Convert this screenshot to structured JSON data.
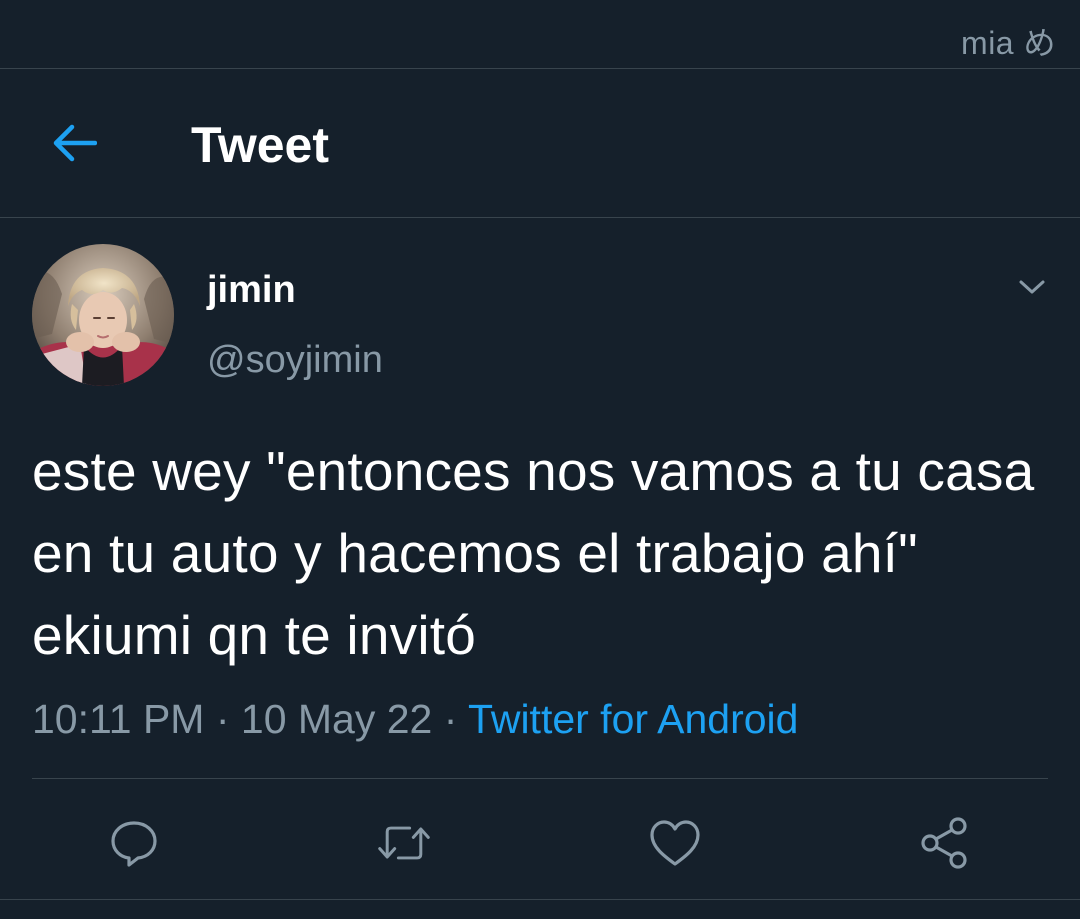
{
  "watermark": "mia め",
  "header": {
    "title": "Tweet",
    "back_icon": "arrow-left-icon"
  },
  "author": {
    "display_name": "jimin",
    "handle": "@soyjimin",
    "caret_icon": "chevron-down-icon"
  },
  "tweet": {
    "text": "este wey \"entonces nos vamos a tu casa en tu auto y hacemos el trabajo ahí\" ekiumi qn te invitó",
    "time": "10:11 PM",
    "date": "10 May 22",
    "separator": " · ",
    "source": "Twitter for Android"
  },
  "actions": {
    "reply_icon": "reply-icon",
    "retweet_icon": "retweet-icon",
    "like_icon": "heart-icon",
    "share_icon": "share-icon"
  },
  "colors": {
    "background": "#15202b",
    "accent": "#1da1f2",
    "secondary_text": "#8899a6",
    "divider": "#38444d"
  }
}
